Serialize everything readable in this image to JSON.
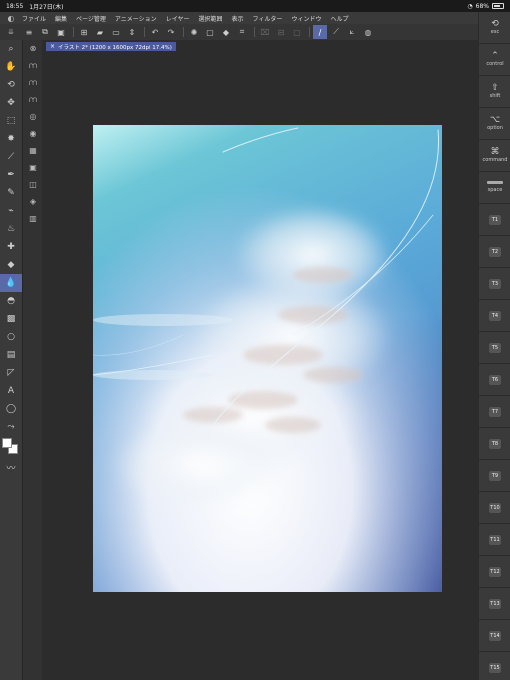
{
  "status": {
    "time": "18:55",
    "date": "1月27日(木)",
    "battery": "68%"
  },
  "menu": {
    "items": [
      "ファイル",
      "編集",
      "ページ管理",
      "アニメーション",
      "レイヤー",
      "選択範囲",
      "表示",
      "フィルター",
      "ウィンドウ",
      "ヘルプ"
    ]
  },
  "document": {
    "tab_title": "イラスト 2* (1200 x 1600px 72dpi 17.4%)"
  },
  "keys": {
    "esc": "esc",
    "control": "control",
    "shift": "shift",
    "option": "option",
    "command": "command",
    "space": "space",
    "numbers": [
      "T1",
      "T2",
      "T3",
      "T4",
      "T5",
      "T6",
      "T7",
      "T8",
      "T9",
      "T10",
      "T11",
      "T12",
      "T13",
      "T14",
      "T15"
    ]
  },
  "colors": {
    "accent": "#5a6aa8",
    "main_color": "#ffffff",
    "sub_color": "#ffffff"
  },
  "icons": {
    "toolbar": [
      "menu-icon",
      "new-icon",
      "gallery-icon",
      "open-icon",
      "save-icon",
      "export-icon",
      "undo-icon",
      "redo-icon",
      "clear-icon",
      "fill-icon",
      "transform-icon",
      "select-icon",
      "pen-sync-icon",
      "ruler-icon",
      "symmetry-icon",
      "snap-icon"
    ],
    "tools": [
      "zoom-icon",
      "hand-icon",
      "rotate-icon",
      "move-icon",
      "selection-icon",
      "auto-select-icon",
      "eyedropper-icon",
      "pen-icon",
      "pencil-icon",
      "brush-icon",
      "airbrush-icon",
      "decoration-icon",
      "eraser-icon",
      "blend-icon",
      "fill-icon",
      "gradient-icon",
      "shape-icon",
      "frame-icon",
      "ruler-icon",
      "text-icon",
      "balloon-icon",
      "correct-line-icon"
    ]
  }
}
